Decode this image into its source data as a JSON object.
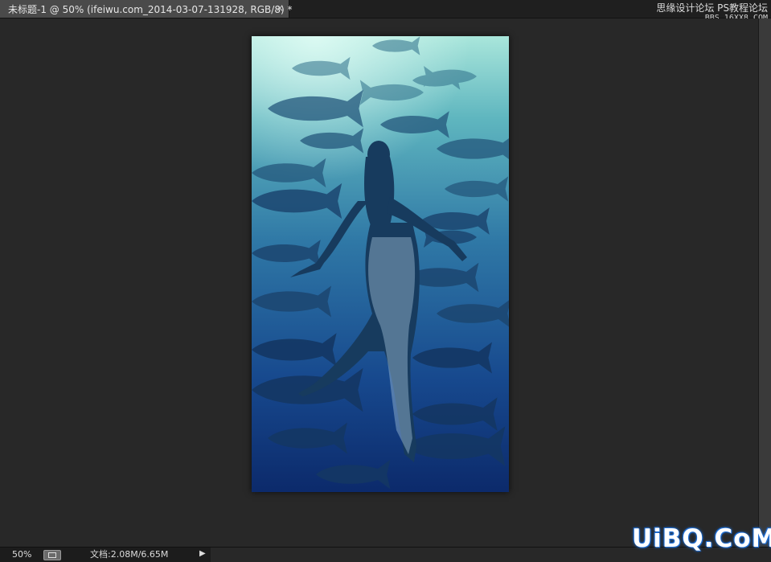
{
  "document": {
    "tab_title": "未标题-1 @ 50% (ifeiwu.com_2014-03-07-131928, RGB/8) *",
    "close_glyph": "×"
  },
  "watermark": {
    "line1": "思缘设计论坛  PS教程论坛",
    "line2": "BBS.16XX8.COM"
  },
  "status": {
    "zoom": "50%",
    "doc_info": "文档:2.08M/6.65M",
    "arrow_glyph": "▶"
  },
  "brand": {
    "text": "UiBQ.CoM",
    "color": "#1f6fd6"
  },
  "colors": {
    "workspace": "#282828",
    "tab_active": "#4a4a4a",
    "water_top": "#9fe0d6",
    "water_bottom": "#0d2f73"
  },
  "icons": {
    "navigator": "navigator-icon",
    "close": "close-icon",
    "menu_arrow": "arrow-right-icon"
  }
}
